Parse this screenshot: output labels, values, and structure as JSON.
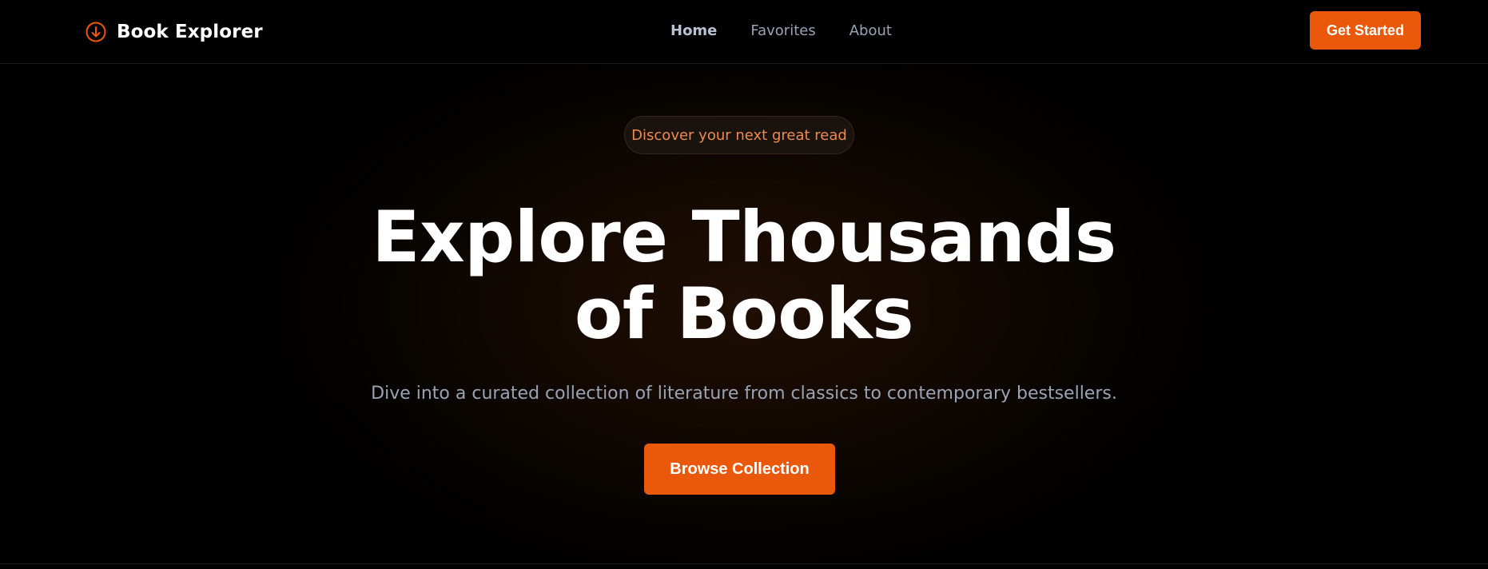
{
  "navbar": {
    "brand": {
      "icon": "arrow-down-circle-icon",
      "name": "Book Explorer",
      "accent_color": "#ea580c"
    },
    "links": [
      {
        "label": "Home",
        "active": true
      },
      {
        "label": "Favorites",
        "active": false
      },
      {
        "label": "About",
        "active": false
      }
    ],
    "cta_label": "Get Started"
  },
  "hero": {
    "badge": "Discover your next great read",
    "title_line1": "Explore Thousands",
    "title_line2": "of Books",
    "subtitle": "Dive into a curated collection of literature from classics to contemporary bestsellers.",
    "button_label": "Browse Collection"
  },
  "colors": {
    "accent": "#ea580c",
    "badge_text": "#f08a4b",
    "muted_text": "#9aa3b5",
    "background": "#000000"
  }
}
